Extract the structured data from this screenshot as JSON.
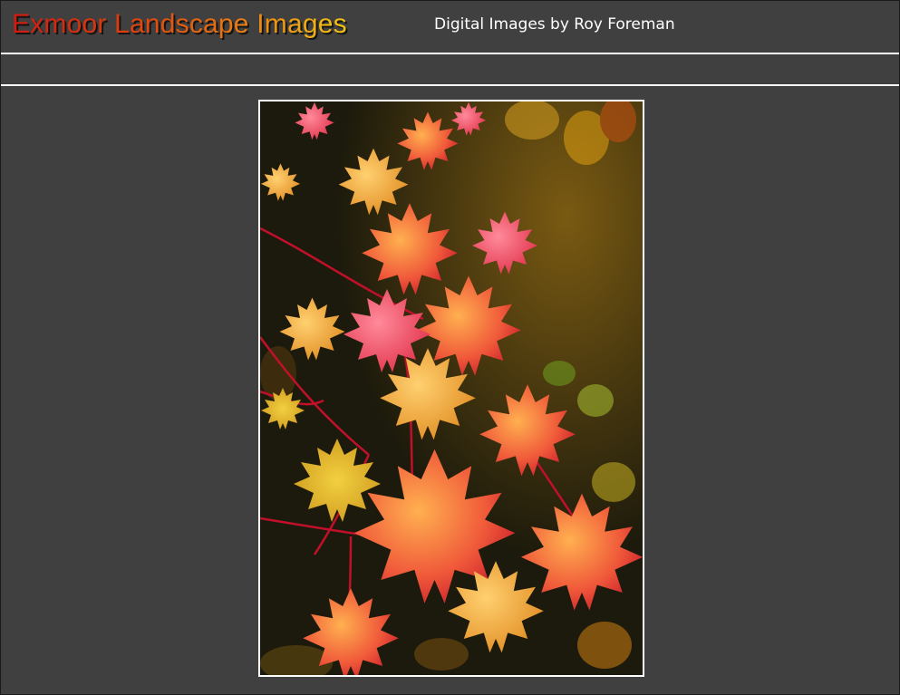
{
  "header": {
    "site_title": "Exmoor Landscape Images",
    "subtitle": "Digital Images by Roy Foreman"
  },
  "photo": {
    "subject": "autumn-leaves-photo-icon"
  },
  "colors": {
    "background": "#404040",
    "rule": "#ffffff",
    "title_gradient_start": "#d11a10",
    "title_gradient_end": "#f3c614"
  }
}
